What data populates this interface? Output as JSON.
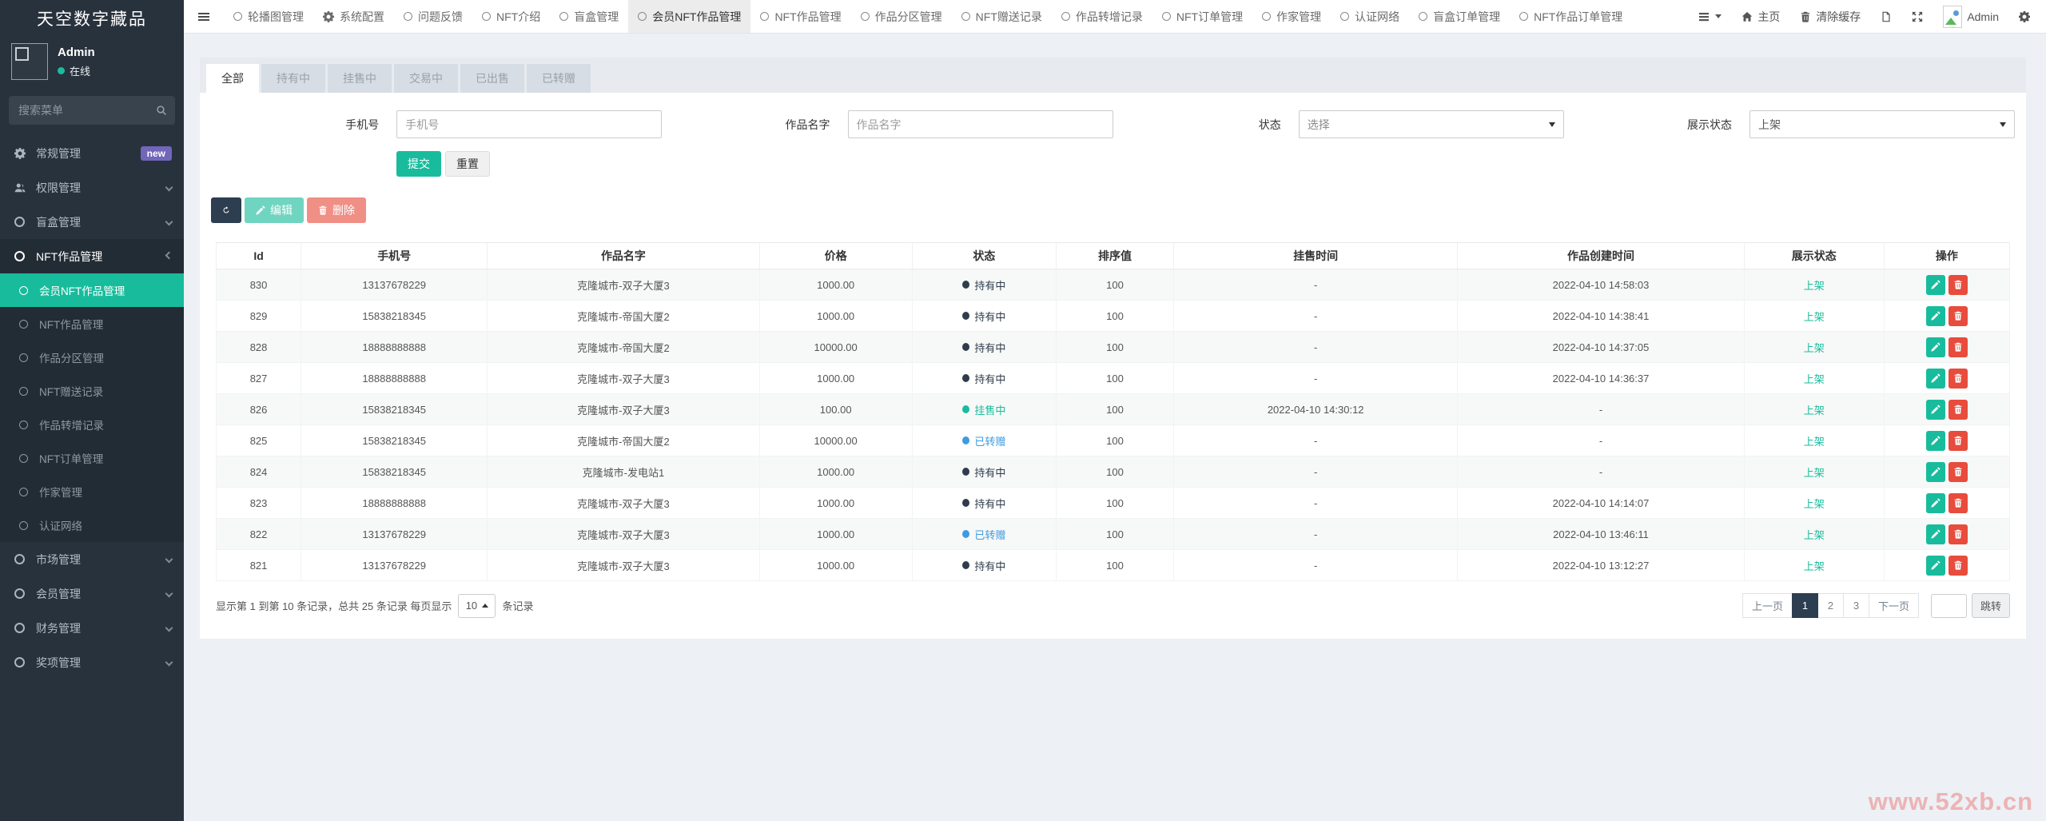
{
  "app": {
    "title": "天空数字藏品",
    "watermark": "www.52xb.cn"
  },
  "colors": {
    "accent": "#18bc9c",
    "dark": "#2c3e50",
    "danger": "#e74c3c",
    "info_blue": "#3498db",
    "badge_purple": "#7266ba"
  },
  "sidebar": {
    "user": {
      "name": "Admin",
      "status": "在线"
    },
    "search_placeholder": "搜索菜单",
    "items": [
      {
        "label": "常规管理",
        "icon": "gear",
        "badge": "new"
      },
      {
        "label": "权限管理",
        "icon": "users",
        "chevron": "left"
      },
      {
        "label": "盲盒管理",
        "icon": "circle",
        "chevron": "left"
      },
      {
        "label": "NFT作品管理",
        "icon": "circle",
        "chevron": "down",
        "expanded": true,
        "children": [
          {
            "label": "会员NFT作品管理",
            "active": true
          },
          {
            "label": "NFT作品管理"
          },
          {
            "label": "作品分区管理"
          },
          {
            "label": "NFT赠送记录"
          },
          {
            "label": "作品转增记录"
          },
          {
            "label": "NFT订单管理"
          },
          {
            "label": "作家管理"
          },
          {
            "label": "认证网络"
          }
        ]
      },
      {
        "label": "市场管理",
        "icon": "circle",
        "chevron": "left"
      },
      {
        "label": "会员管理",
        "icon": "circle",
        "chevron": "left"
      },
      {
        "label": "财务管理",
        "icon": "circle",
        "chevron": "left"
      },
      {
        "label": "奖项管理",
        "icon": "circle",
        "chevron": "left"
      }
    ]
  },
  "navbar": {
    "tabs": [
      {
        "label": "轮播图管理",
        "icon": "circle"
      },
      {
        "label": "系统配置",
        "icon": "gear"
      },
      {
        "label": "问题反馈",
        "icon": "circle"
      },
      {
        "label": "NFT介绍",
        "icon": "circle"
      },
      {
        "label": "盲盒管理",
        "icon": "circle"
      },
      {
        "label": "会员NFT作品管理",
        "icon": "circle",
        "active": true
      },
      {
        "label": "NFT作品管理",
        "icon": "circle"
      },
      {
        "label": "作品分区管理",
        "icon": "circle"
      },
      {
        "label": "NFT赠送记录",
        "icon": "circle"
      },
      {
        "label": "作品转增记录",
        "icon": "circle"
      },
      {
        "label": "NFT订单管理",
        "icon": "circle"
      },
      {
        "label": "作家管理",
        "icon": "circle"
      },
      {
        "label": "认证网络",
        "icon": "circle"
      },
      {
        "label": "盲盒订单管理",
        "icon": "circle"
      },
      {
        "label": "NFT作品订单管理",
        "icon": "circle"
      }
    ],
    "tools": {
      "home": "主页",
      "clear_cache": "清除缓存",
      "user": "Admin"
    }
  },
  "filters": {
    "tabs": [
      {
        "label": "全部",
        "active": true
      },
      {
        "label": "持有中"
      },
      {
        "label": "挂售中"
      },
      {
        "label": "交易中"
      },
      {
        "label": "已出售"
      },
      {
        "label": "已转赠"
      }
    ]
  },
  "form": {
    "phone_label": "手机号",
    "phone_placeholder": "手机号",
    "name_label": "作品名字",
    "name_placeholder": "作品名字",
    "status_label": "状态",
    "status_value": "选择",
    "display_label": "展示状态",
    "display_value": "上架",
    "submit": "提交",
    "reset": "重置"
  },
  "toolbar": {
    "edit": "编辑",
    "delete": "删除"
  },
  "table": {
    "columns": [
      "Id",
      "手机号",
      "作品名字",
      "价格",
      "状态",
      "排序值",
      "挂售时间",
      "作品创建时间",
      "展示状态",
      "操作"
    ],
    "rows": [
      {
        "id": "830",
        "phone": "13137678229",
        "name": "克隆城市-双子大厦3",
        "price": "1000.00",
        "status": "持有中",
        "status_type": "hold",
        "sort": "100",
        "list_time": "-",
        "create_time": "2022-04-10 14:58:03",
        "display": "上架"
      },
      {
        "id": "829",
        "phone": "15838218345",
        "name": "克隆城市-帝国大厦2",
        "price": "1000.00",
        "status": "持有中",
        "status_type": "hold",
        "sort": "100",
        "list_time": "-",
        "create_time": "2022-04-10 14:38:41",
        "display": "上架"
      },
      {
        "id": "828",
        "phone": "18888888888",
        "name": "克隆城市-帝国大厦2",
        "price": "10000.00",
        "status": "持有中",
        "status_type": "hold",
        "sort": "100",
        "list_time": "-",
        "create_time": "2022-04-10 14:37:05",
        "display": "上架"
      },
      {
        "id": "827",
        "phone": "18888888888",
        "name": "克隆城市-双子大厦3",
        "price": "1000.00",
        "status": "持有中",
        "status_type": "hold",
        "sort": "100",
        "list_time": "-",
        "create_time": "2022-04-10 14:36:37",
        "display": "上架"
      },
      {
        "id": "826",
        "phone": "15838218345",
        "name": "克隆城市-双子大厦3",
        "price": "100.00",
        "status": "挂售中",
        "status_type": "sale",
        "sort": "100",
        "list_time": "2022-04-10 14:30:12",
        "create_time": "-",
        "display": "上架"
      },
      {
        "id": "825",
        "phone": "15838218345",
        "name": "克隆城市-帝国大厦2",
        "price": "10000.00",
        "status": "已转赠",
        "status_type": "gift",
        "sort": "100",
        "list_time": "-",
        "create_time": "-",
        "display": "上架"
      },
      {
        "id": "824",
        "phone": "15838218345",
        "name": "克隆城市-发电站1",
        "price": "1000.00",
        "status": "持有中",
        "status_type": "hold",
        "sort": "100",
        "list_time": "-",
        "create_time": "-",
        "display": "上架"
      },
      {
        "id": "823",
        "phone": "18888888888",
        "name": "克隆城市-双子大厦3",
        "price": "1000.00",
        "status": "持有中",
        "status_type": "hold",
        "sort": "100",
        "list_time": "-",
        "create_time": "2022-04-10 14:14:07",
        "display": "上架"
      },
      {
        "id": "822",
        "phone": "13137678229",
        "name": "克隆城市-双子大厦3",
        "price": "1000.00",
        "status": "已转赠",
        "status_type": "gift",
        "sort": "100",
        "list_time": "-",
        "create_time": "2022-04-10 13:46:11",
        "display": "上架"
      },
      {
        "id": "821",
        "phone": "13137678229",
        "name": "克隆城市-双子大厦3",
        "price": "1000.00",
        "status": "持有中",
        "status_type": "hold",
        "sort": "100",
        "list_time": "-",
        "create_time": "2022-04-10 13:12:27",
        "display": "上架"
      }
    ]
  },
  "pagination": {
    "info": "显示第 1 到第 10 条记录，总共 25 条记录 每页显示",
    "page_size": "10",
    "info_suffix": "条记录",
    "prev": "上一页",
    "pages": [
      "1",
      "2",
      "3"
    ],
    "active_page": "1",
    "next": "下一页",
    "jump": "跳转"
  }
}
